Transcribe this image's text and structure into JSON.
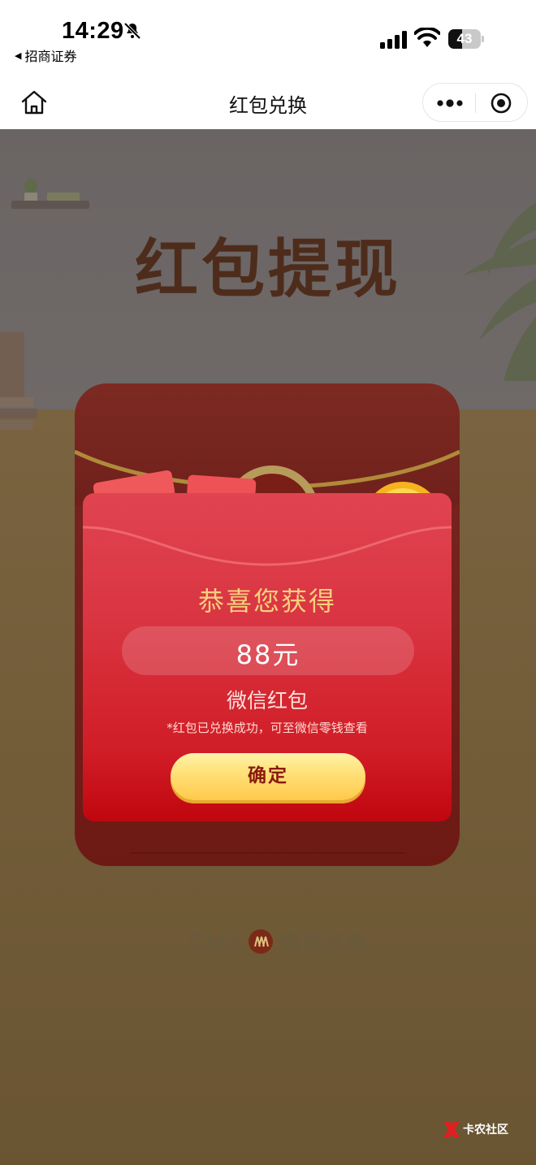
{
  "status_bar": {
    "time": "14:29",
    "back_app_label": "招商证券",
    "battery_percent": 43,
    "battery_label": "43"
  },
  "nav": {
    "title": "红包兑换",
    "icons": [
      "home-icon",
      "more-icon",
      "close-mini-program-icon"
    ]
  },
  "hero": {
    "title": "红包提现"
  },
  "modal": {
    "congrats": "恭喜您获得",
    "amount": "88元",
    "reward_type": "微信红包",
    "note": "*红包已兑换成功，可至微信零钱查看",
    "confirm_label": "确定"
  },
  "brand": {
    "en": "CMS",
    "cn": "招商证券"
  },
  "watermark": {
    "text": "卡农社区"
  },
  "colors": {
    "envelope_dark": "#6e1f1a",
    "envelope_red": "#d93441",
    "gold_text": "#f7cf7d",
    "button_gold": "#ffd760",
    "button_text": "#8a1a0e"
  }
}
